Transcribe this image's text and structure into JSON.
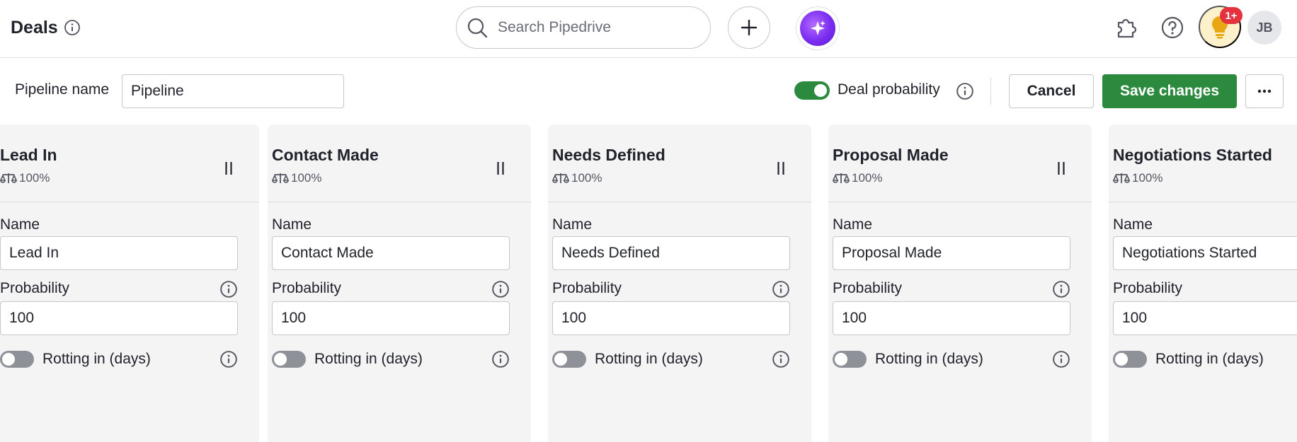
{
  "header": {
    "title": "Deals",
    "search_placeholder": "Search Pipedrive",
    "notification_badge": "1+",
    "avatar_initials": "JB",
    "icons": [
      "info-icon",
      "search-icon",
      "plus-icon",
      "ai-sparkle-icon",
      "puzzle-icon",
      "help-icon",
      "lightbulb-icon"
    ]
  },
  "editbar": {
    "pipeline_label": "Pipeline name",
    "pipeline_value": "Pipeline",
    "deal_probability_label": "Deal probability",
    "deal_probability_enabled": true,
    "cancel_label": "Cancel",
    "save_label": "Save changes",
    "more_label": "···"
  },
  "stages": [
    {
      "title": "Lead In",
      "probability_display": "100%",
      "name_label": "Name",
      "name_value": "Lead In",
      "probability_label": "Probability",
      "probability_value": "100",
      "rotting_label": "Rotting in (days)",
      "rotting_enabled": false
    },
    {
      "title": "Contact Made",
      "probability_display": "100%",
      "name_label": "Name",
      "name_value": "Contact Made",
      "probability_label": "Probability",
      "probability_value": "100",
      "rotting_label": "Rotting in (days)",
      "rotting_enabled": false
    },
    {
      "title": "Needs Defined",
      "probability_display": "100%",
      "name_label": "Name",
      "name_value": "Needs Defined",
      "probability_label": "Probability",
      "probability_value": "100",
      "rotting_label": "Rotting in (days)",
      "rotting_enabled": false
    },
    {
      "title": "Proposal Made",
      "probability_display": "100%",
      "name_label": "Name",
      "name_value": "Proposal Made",
      "probability_label": "Probability",
      "probability_value": "100",
      "rotting_label": "Rotting in (days)",
      "rotting_enabled": false
    },
    {
      "title": "Negotiations Started",
      "probability_display": "100%",
      "name_label": "Name",
      "name_value": "Negotiations Started",
      "probability_label": "Probability",
      "probability_value": "100",
      "rotting_label": "Rotting in (days)",
      "rotting_enabled": false
    }
  ],
  "colors": {
    "primary_green": "#2b8a3e",
    "toggle_off": "#8f9199",
    "column_bg": "#f4f4f5",
    "badge_red": "#e5323f",
    "bulb_bg": "#fdf1cc",
    "ai_purple": "#7a2cf0"
  }
}
